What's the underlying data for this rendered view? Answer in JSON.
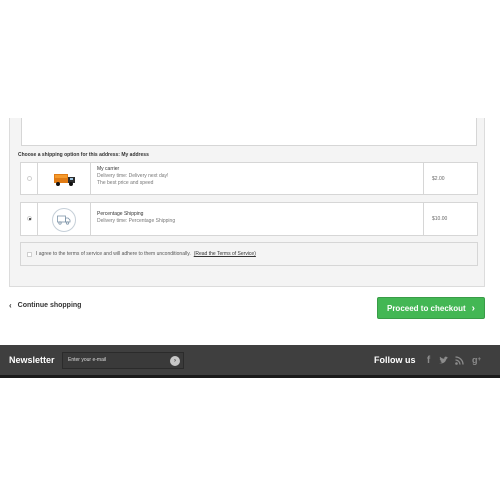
{
  "shipping": {
    "title": "Choose a shipping option for this address: My address",
    "carriers": [
      {
        "name": "My carrier",
        "lines": [
          "Delivery time: Delivery next day!",
          "The best price and speed"
        ],
        "price": "$2.00",
        "selected": false,
        "icon": "delivery-truck-icon"
      },
      {
        "name": "Percentage Shipping",
        "lines": [
          "Delivery time: Percentage Shipping"
        ],
        "price": "$10.00",
        "selected": true,
        "icon": "shipping-truck-icon"
      }
    ]
  },
  "terms": {
    "text": "I agree to the terms of service and will adhere to them unconditionally.",
    "link": "(Read the Terms of Service)"
  },
  "actions": {
    "continue_label": "Continue shopping",
    "checkout_label": "Proceed to checkout"
  },
  "footer": {
    "newsletter_label": "Newsletter",
    "newsletter_placeholder": "Enter your e-mail",
    "follow_label": "Follow us",
    "social_icons": [
      "facebook-icon",
      "twitter-icon",
      "rss-icon",
      "google-plus-icon"
    ]
  },
  "colors": {
    "checkout_green": "#43b754",
    "footer_bg": "#3f3f3f",
    "panel_bg": "#f4f4f4"
  }
}
